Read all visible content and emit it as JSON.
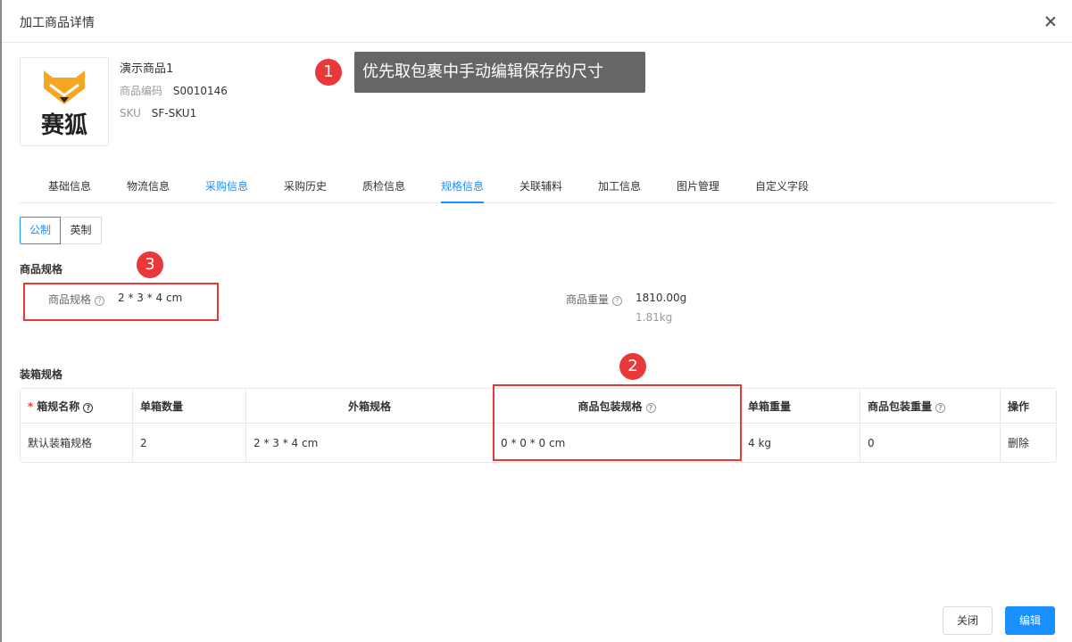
{
  "modal": {
    "title": "加工商品详情"
  },
  "product": {
    "name": "演示商品1",
    "code_label": "商品编码",
    "code": "S0010146",
    "sku_label": "SKU",
    "sku": "SF-SKU1",
    "logo_text": "赛狐"
  },
  "annotations": [
    {
      "num": "1",
      "text": "优先取包裹中手动编辑保存的尺寸"
    },
    {
      "num": "2"
    },
    {
      "num": "3"
    }
  ],
  "tabs": [
    {
      "label": "基础信息"
    },
    {
      "label": "物流信息"
    },
    {
      "label": "采购信息"
    },
    {
      "label": "采购历史"
    },
    {
      "label": "质检信息"
    },
    {
      "label": "规格信息"
    },
    {
      "label": "关联辅料"
    },
    {
      "label": "加工信息"
    },
    {
      "label": "图片管理"
    },
    {
      "label": "自定义字段"
    }
  ],
  "active_tab": "规格信息",
  "unit_toggle": {
    "metric": "公制",
    "imperial": "英制",
    "selected": "公制"
  },
  "spec": {
    "section_title": "商品规格",
    "spec_label": "商品规格",
    "spec_value": "2 * 3 * 4 cm",
    "weight_label": "商品重量",
    "weight_value": "1810.00g",
    "weight_kg": "1.81kg"
  },
  "box": {
    "section_title": "装箱规格",
    "columns": [
      "箱规名称",
      "单箱数量",
      "外箱规格",
      "商品包装规格",
      "单箱重量",
      "商品包装重量",
      "操作"
    ],
    "rows": [
      {
        "name": "默认装箱规格",
        "qty": "2",
        "outer": "2 * 3 * 4 cm",
        "pack": "0 * 0 * 0 cm",
        "box_weight": "4 kg",
        "pack_weight": "0",
        "action": "删除"
      }
    ]
  },
  "footer": {
    "close_label": "关闭",
    "edit_label": "编辑"
  },
  "colors": {
    "primary": "#1890ff",
    "annotation_red": "#e8383a",
    "tooltip_gray": "#666666",
    "logo_orange": "#f5a623"
  }
}
